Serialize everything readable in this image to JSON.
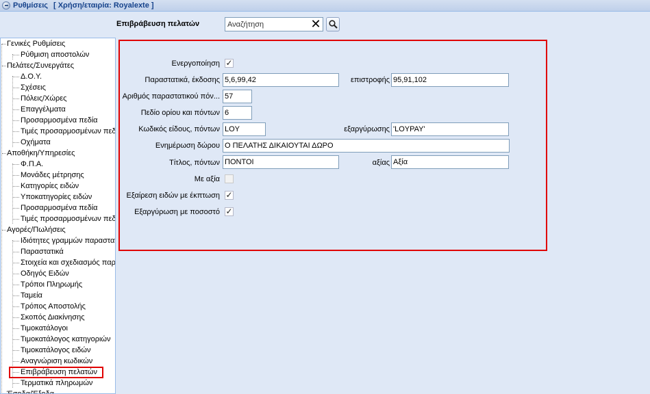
{
  "window": {
    "title": "Ρυθμίσεις",
    "company": "[ Χρήση/εταιρία: Royalexte ]"
  },
  "search": {
    "section_label": "Επιβράβευση πελατών",
    "value": "Αναζήτηση"
  },
  "tree": [
    {
      "label": "Γενικές Ρυθμίσεις",
      "level": 0
    },
    {
      "label": "Ρύθμιση αποστολών",
      "level": 1
    },
    {
      "label": "Πελάτες/Συνεργάτες",
      "level": 0
    },
    {
      "label": "Δ.Ο.Υ.",
      "level": 1
    },
    {
      "label": "Σχέσεις",
      "level": 1
    },
    {
      "label": "Πόλεις/Χώρες",
      "level": 1
    },
    {
      "label": "Επαγγέλματα",
      "level": 1
    },
    {
      "label": "Προσαρμοσμένα πεδία",
      "level": 1
    },
    {
      "label": "Τιμές προσαρμοσμένων πεδ",
      "level": 1
    },
    {
      "label": "Οχήματα",
      "level": 1
    },
    {
      "label": "Αποθήκη/Υπηρεσίες",
      "level": 0
    },
    {
      "label": "Φ.Π.Α.",
      "level": 1
    },
    {
      "label": "Μονάδες μέτρησης",
      "level": 1
    },
    {
      "label": "Κατηγορίες ειδών",
      "level": 1
    },
    {
      "label": "Υποκατηγορίες ειδών",
      "level": 1
    },
    {
      "label": "Προσαρμοσμένα πεδία",
      "level": 1
    },
    {
      "label": "Τιμές προσαρμοσμένων πεδ",
      "level": 1
    },
    {
      "label": "Αγορές/Πωλήσεις",
      "level": 0
    },
    {
      "label": "Ιδιότητες γραμμών παραστατ",
      "level": 1
    },
    {
      "label": "Παραστατικά",
      "level": 1
    },
    {
      "label": "Στοιχεία και σχεδιασμός παρα",
      "level": 1
    },
    {
      "label": "Οδηγός Ειδών",
      "level": 1
    },
    {
      "label": "Τρόποι Πληρωμής",
      "level": 1
    },
    {
      "label": "Ταμεία",
      "level": 1
    },
    {
      "label": "Τρόπος Αποστολής",
      "level": 1
    },
    {
      "label": "Σκοπός Διακίνησης",
      "level": 1
    },
    {
      "label": "Τιμοκατάλογοι",
      "level": 1
    },
    {
      "label": "Τιμοκατάλογος κατηγοριών",
      "level": 1
    },
    {
      "label": "Τιμοκατάλογος ειδών",
      "level": 1
    },
    {
      "label": "Αναγνώριση κωδικών",
      "level": 1
    },
    {
      "label": "Επιβράβευση πελατών",
      "level": 1,
      "selected": true
    },
    {
      "label": "Τερματικά πληρωμών",
      "level": 1
    },
    {
      "label": "Έσοδα/Έξοδα",
      "level": 0
    }
  ],
  "form": {
    "activation_label": "Ενεργοποίηση",
    "activation_checked": true,
    "documents_issue_label": "Παραστατικά, έκδοσης",
    "documents_issue_value": "5,6,99,42",
    "return_label": "επιστροφής",
    "return_value": "95,91,102",
    "doc_number_label": "Αριθμός παραστατικού πόν...",
    "doc_number_value": "57",
    "limit_field_label": "Πεδίο ορίου και πόντων",
    "limit_field_value": "6",
    "item_code_label": "Κωδικός είδους, πόντων",
    "item_code_value": "LOY",
    "redeem_label": "εξαργύρωσης",
    "redeem_value": "'LOYPAY'",
    "gift_notice_label": "Ενημέρωση δώρου",
    "gift_notice_value": "Ο ΠΕΛΑΤΗΣ ΔΙΚΑΙΟΥΤΑΙ ΔΩΡΟ",
    "points_title_label": "Τίτλος, πόντων",
    "points_title_value": "ΠΟΝΤΟΙ",
    "value_label": "αξίας",
    "value_value": "Αξία",
    "with_value_label": "Με αξία",
    "with_value_checked": false,
    "exclude_discount_label": "Εξαίρεση ειδών με έκπτωση",
    "exclude_discount_checked": true,
    "redeem_percent_label": "Εξαργύρωση με ποσοστό",
    "redeem_percent_checked": true
  },
  "colors": {
    "highlight": "#e00000",
    "background": "#dfe8f6",
    "title_text": "#15428b"
  }
}
